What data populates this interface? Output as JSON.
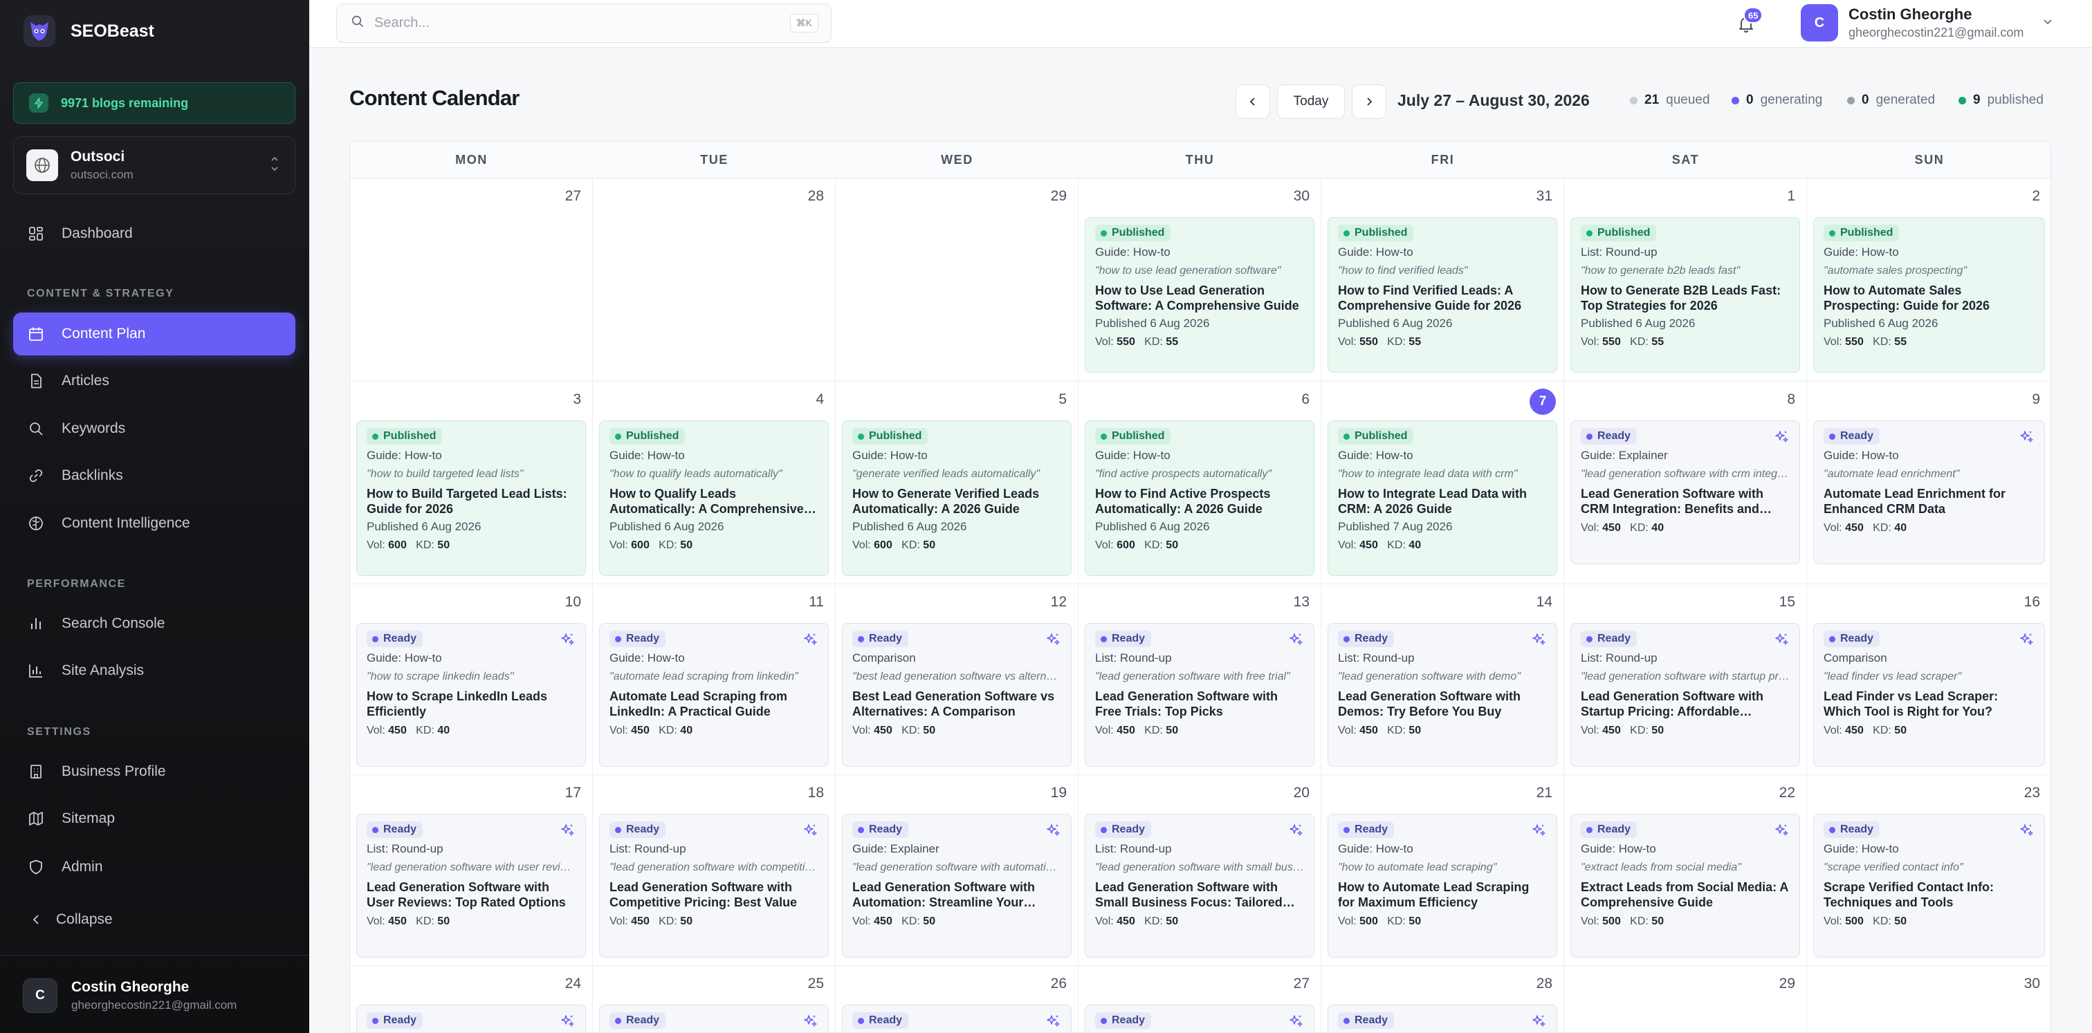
{
  "app": {
    "name": "SEOBeast",
    "blogs_remaining": "9971 blogs remaining"
  },
  "site": {
    "name": "Outsoci",
    "domain": "outsoci.com"
  },
  "nav": {
    "dashboard": "Dashboard",
    "section_content": "CONTENT & STRATEGY",
    "content_plan": "Content Plan",
    "articles": "Articles",
    "keywords": "Keywords",
    "backlinks": "Backlinks",
    "content_intelligence": "Content Intelligence",
    "section_performance": "PERFORMANCE",
    "search_console": "Search Console",
    "site_analysis": "Site Analysis",
    "section_settings": "SETTINGS",
    "business_profile": "Business Profile",
    "sitemap": "Sitemap",
    "admin": "Admin",
    "collapse": "Collapse"
  },
  "user": {
    "name": "Costin Gheorghe",
    "email": "gheorghecostin221@gmail.com",
    "initial": "C"
  },
  "topbar": {
    "search_placeholder": "Search...",
    "shortcut": "⌘K",
    "notifications": "65"
  },
  "header": {
    "title": "Content Calendar",
    "today": "Today",
    "range": "July 27 – August 30, 2026",
    "stats": [
      {
        "count": "21",
        "label": "queued",
        "color": "#c9ccd4"
      },
      {
        "count": "0",
        "label": "generating",
        "color": "#6a5cf6"
      },
      {
        "count": "0",
        "label": "generated",
        "color": "#9aa0ab"
      },
      {
        "count": "9",
        "label": "published",
        "color": "#17a66b"
      }
    ]
  },
  "calendar": {
    "weekdays": [
      "MON",
      "TUE",
      "WED",
      "THU",
      "FRI",
      "SAT",
      "SUN"
    ],
    "today": "7",
    "weeks": [
      [
        {
          "day": "27"
        },
        {
          "day": "28"
        },
        {
          "day": "29"
        },
        {
          "day": "30",
          "status": "Published",
          "type": "Guide: How-to",
          "keyword": "\"how to use lead generation software\"",
          "title": "How to Use Lead Generation Software: A Comprehensive Guide",
          "published": "Published 6 Aug 2026",
          "vol": "550",
          "kd": "55"
        },
        {
          "day": "31",
          "status": "Published",
          "type": "Guide: How-to",
          "keyword": "\"how to find verified leads\"",
          "title": "How to Find Verified Leads: A Comprehensive Guide for 2026",
          "published": "Published 6 Aug 2026",
          "vol": "550",
          "kd": "55"
        },
        {
          "day": "1",
          "status": "Published",
          "type": "List: Round-up",
          "keyword": "\"how to generate b2b leads fast\"",
          "title": "How to Generate B2B Leads Fast: Top Strategies for 2026",
          "published": "Published 6 Aug 2026",
          "vol": "550",
          "kd": "55"
        },
        {
          "day": "2",
          "status": "Published",
          "type": "Guide: How-to",
          "keyword": "\"automate sales prospecting\"",
          "title": "How to Automate Sales Prospecting: Guide for 2026",
          "published": "Published 6 Aug 2026",
          "vol": "550",
          "kd": "55"
        }
      ],
      [
        {
          "day": "3",
          "status": "Published",
          "type": "Guide: How-to",
          "keyword": "\"how to build targeted lead lists\"",
          "title": "How to Build Targeted Lead Lists: Guide for 2026",
          "published": "Published 6 Aug 2026",
          "vol": "600",
          "kd": "50"
        },
        {
          "day": "4",
          "status": "Published",
          "type": "Guide: How-to",
          "keyword": "\"how to qualify leads automatically\"",
          "title": "How to Qualify Leads Automatically: A Comprehensive Guide",
          "published": "Published 6 Aug 2026",
          "vol": "600",
          "kd": "50"
        },
        {
          "day": "5",
          "status": "Published",
          "type": "Guide: How-to",
          "keyword": "\"generate verified leads automatically\"",
          "title": "How to Generate Verified Leads Automatically: A 2026 Guide",
          "published": "Published 6 Aug 2026",
          "vol": "600",
          "kd": "50"
        },
        {
          "day": "6",
          "status": "Published",
          "type": "Guide: How-to",
          "keyword": "\"find active prospects automatically\"",
          "title": "How to Find Active Prospects Automatically: A 2026 Guide",
          "published": "Published 6 Aug 2026",
          "vol": "600",
          "kd": "50"
        },
        {
          "day": "7",
          "status": "Published",
          "type": "Guide: How-to",
          "keyword": "\"how to integrate lead data with crm\"",
          "title": "How to Integrate Lead Data with CRM: A 2026 Guide",
          "published": "Published 7 Aug 2026",
          "vol": "450",
          "kd": "40"
        },
        {
          "day": "8",
          "status": "Ready",
          "type": "Guide: Explainer",
          "keyword": "\"lead generation software with crm integration\"",
          "title": "Lead Generation Software with CRM Integration: Benefits and Features",
          "vol": "450",
          "kd": "40"
        },
        {
          "day": "9",
          "status": "Ready",
          "type": "Guide: How-to",
          "keyword": "\"automate lead enrichment\"",
          "title": "Automate Lead Enrichment for Enhanced CRM Data",
          "vol": "450",
          "kd": "40"
        }
      ],
      [
        {
          "day": "10",
          "status": "Ready",
          "type": "Guide: How-to",
          "keyword": "\"how to scrape linkedin leads\"",
          "title": "How to Scrape LinkedIn Leads Efficiently",
          "vol": "450",
          "kd": "40"
        },
        {
          "day": "11",
          "status": "Ready",
          "type": "Guide: How-to",
          "keyword": "\"automate lead scraping from linkedin\"",
          "title": "Automate Lead Scraping from LinkedIn: A Practical Guide",
          "vol": "450",
          "kd": "40"
        },
        {
          "day": "12",
          "status": "Ready",
          "type": "Comparison",
          "keyword": "\"best lead generation software vs alternatives\"",
          "title": "Best Lead Generation Software vs Alternatives: A Comparison",
          "vol": "450",
          "kd": "50"
        },
        {
          "day": "13",
          "status": "Ready",
          "type": "List: Round-up",
          "keyword": "\"lead generation software with free trial\"",
          "title": "Lead Generation Software with Free Trials: Top Picks",
          "vol": "450",
          "kd": "50"
        },
        {
          "day": "14",
          "status": "Ready",
          "type": "List: Round-up",
          "keyword": "\"lead generation software with demo\"",
          "title": "Lead Generation Software with Demos: Try Before You Buy",
          "vol": "450",
          "kd": "50"
        },
        {
          "day": "15",
          "status": "Ready",
          "type": "List: Round-up",
          "keyword": "\"lead generation software with startup pricing\"",
          "title": "Lead Generation Software with Startup Pricing: Affordable Options",
          "vol": "450",
          "kd": "50"
        },
        {
          "day": "16",
          "status": "Ready",
          "type": "Comparison",
          "keyword": "\"lead finder vs lead scraper\"",
          "title": "Lead Finder vs Lead Scraper: Which Tool is Right for You?",
          "vol": "450",
          "kd": "50"
        }
      ],
      [
        {
          "day": "17",
          "status": "Ready",
          "type": "List: Round-up",
          "keyword": "\"lead generation software with user reviews\"",
          "title": "Lead Generation Software with User Reviews: Top Rated Options",
          "vol": "450",
          "kd": "50"
        },
        {
          "day": "18",
          "status": "Ready",
          "type": "List: Round-up",
          "keyword": "\"lead generation software with competitive pricing\"",
          "title": "Lead Generation Software with Competitive Pricing: Best Value",
          "vol": "450",
          "kd": "50"
        },
        {
          "day": "19",
          "status": "Ready",
          "type": "Guide: Explainer",
          "keyword": "\"lead generation software with automation\"",
          "title": "Lead Generation Software with Automation: Streamline Your Workflow",
          "vol": "450",
          "kd": "50"
        },
        {
          "day": "20",
          "status": "Ready",
          "type": "List: Round-up",
          "keyword": "\"lead generation software with small business focus\"",
          "title": "Lead Generation Software with Small Business Focus: Tailored Solutions",
          "vol": "450",
          "kd": "50"
        },
        {
          "day": "21",
          "status": "Ready",
          "type": "Guide: How-to",
          "keyword": "\"how to automate lead scraping\"",
          "title": "How to Automate Lead Scraping for Maximum Efficiency",
          "vol": "500",
          "kd": "50"
        },
        {
          "day": "22",
          "status": "Ready",
          "type": "Guide: How-to",
          "keyword": "\"extract leads from social media\"",
          "title": "Extract Leads from Social Media: A Comprehensive Guide",
          "vol": "500",
          "kd": "50"
        },
        {
          "day": "23",
          "status": "Ready",
          "type": "Guide: How-to",
          "keyword": "\"scrape verified contact info\"",
          "title": "Scrape Verified Contact Info: Techniques and Tools",
          "vol": "500",
          "kd": "50"
        }
      ],
      [
        {
          "day": "24",
          "status": "Ready"
        },
        {
          "day": "25",
          "status": "Ready"
        },
        {
          "day": "26",
          "status": "Ready"
        },
        {
          "day": "27",
          "status": "Ready"
        },
        {
          "day": "28",
          "status": "Ready"
        },
        {
          "day": "29"
        },
        {
          "day": "30"
        }
      ]
    ]
  }
}
